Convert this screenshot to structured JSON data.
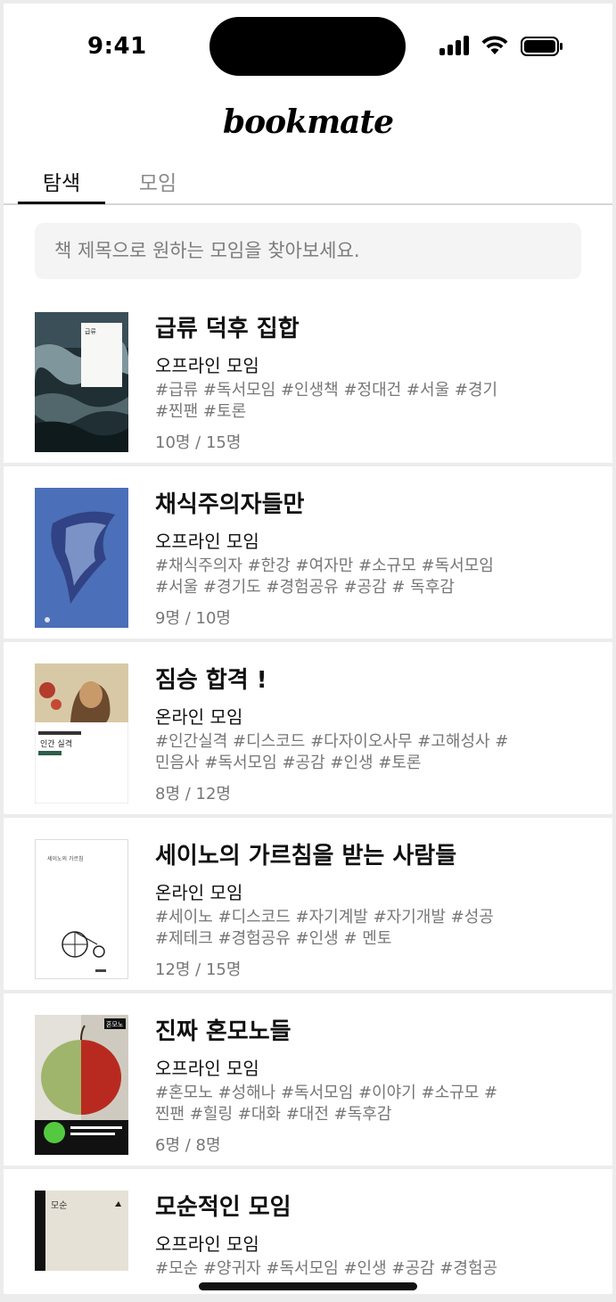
{
  "status_bar": {
    "time": "9:41"
  },
  "app": {
    "logo": "bookmate"
  },
  "tabs": [
    {
      "label": "탐색",
      "active": true
    },
    {
      "label": "모임",
      "active": false
    }
  ],
  "search": {
    "placeholder": "책 제목으로 원하는 모임을 찾아보세요."
  },
  "groups": [
    {
      "title": "급류 덕후 집합",
      "type": "오프라인 모임",
      "tags": "#급류 #독서모임 #인생책 #정대건 #서울 #경기 #찐팬 #토론",
      "members": "10명 / 15명",
      "cover_icon": "book-cover-waves"
    },
    {
      "title": "채식주의자들만",
      "type": "오프라인 모임",
      "tags": "#채식주의자 #한강 #여자만 #소규모 #독서모임 #서울 #경기도 #경험공유 #공감 # 독후감",
      "members": "9명 / 10명",
      "cover_icon": "book-cover-blue-fabric"
    },
    {
      "title": "짐승 합격 !",
      "type": "온라인 모임",
      "tags": "#인간실격 #디스코드 #다자이오사무 #고해성사 #민음사 #독서모임 #공감 #인생 #토론",
      "members": "8명 / 12명",
      "cover_icon": "book-cover-portrait"
    },
    {
      "title": "세이노의 가르침을 받는 사람들",
      "type": "온라인 모임",
      "tags": "#세이노 #디스코드 #자기계발 #자기개발 #성공 #제테크 #경험공유 #인생 # 멘토",
      "members": "12명 / 15명",
      "cover_icon": "book-cover-bicycle"
    },
    {
      "title": "진짜 혼모노들",
      "type": "오프라인 모임",
      "tags": "#혼모노 #성해나 #독서모임 #이야기 #소규모 # 찐팬 #힐링 #대화 #대전 #독후감",
      "members": "6명 / 8명",
      "cover_icon": "book-cover-apple"
    },
    {
      "title": "모순적인 모임",
      "type": "오프라인 모임",
      "tags": "#모순 #양귀자 #독서모임 #인생 #공감 #경험공",
      "members": "",
      "cover_icon": "book-cover-beige"
    }
  ],
  "cover_text": {
    "c1": "급류",
    "c3": "인간 실격",
    "c4": "세이노의 가르침",
    "c5": "혼모노",
    "c6": "모순"
  }
}
